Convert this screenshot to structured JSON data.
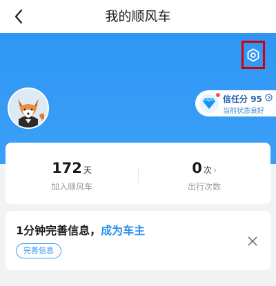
{
  "nav": {
    "title": "我的顺风车",
    "back_icon": "chevron-left-icon"
  },
  "hero": {
    "settings_icon": "gear-icon",
    "avatar_icon": "fox-avatar-icon",
    "trust": {
      "label": "信任分",
      "score": "95",
      "status": "当前状态良好",
      "badge_icon": "diamond-icon",
      "arrow_icon": "chevron-right-circle-icon"
    }
  },
  "stats": {
    "joined": {
      "value": "172",
      "unit": "天",
      "label": "加入顺风车"
    },
    "trips": {
      "value": "0",
      "unit": "次",
      "arrow": "›",
      "label": "出行次数"
    }
  },
  "promo": {
    "text": "1分钟完善信息，",
    "link": "成为车主",
    "button": "完善信息",
    "close_icon": "close-icon"
  },
  "colors": {
    "accent": "#2f96f5",
    "highlight_box": "#d40000",
    "link": "#2b8ff0"
  }
}
